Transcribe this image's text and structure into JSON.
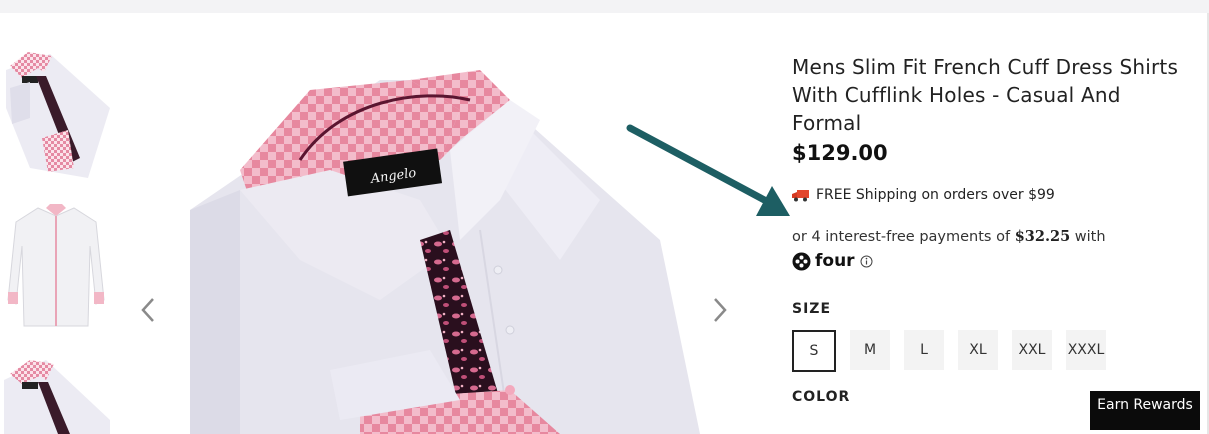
{
  "product": {
    "title": "Mens Slim Fit French Cuff Dress Shirts With Cufflink Holes - Casual And Formal",
    "price": "$129.00"
  },
  "shipping": {
    "icon": "truck-icon",
    "text": "FREE Shipping on orders over $99"
  },
  "installments": {
    "prefix": "or 4 interest-free payments of",
    "amount": "$32.25",
    "suffix": "with",
    "provider": "four"
  },
  "size": {
    "label": "SIZE",
    "options": [
      "S",
      "M",
      "L",
      "XL",
      "XXL",
      "XXXL"
    ],
    "selected": "S"
  },
  "color": {
    "label": "COLOR"
  },
  "rewards": {
    "label": "Earn Rewards"
  },
  "gallery": {
    "prev_icon": "chevron-left-icon",
    "next_icon": "chevron-right-icon"
  },
  "colors": {
    "annotation_arrow": "#1d5e63",
    "shirt": "#e8e8f0",
    "check_pink": "#e08aa0",
    "price_text": "#111111",
    "rewards_bg": "#0b0b0b"
  }
}
